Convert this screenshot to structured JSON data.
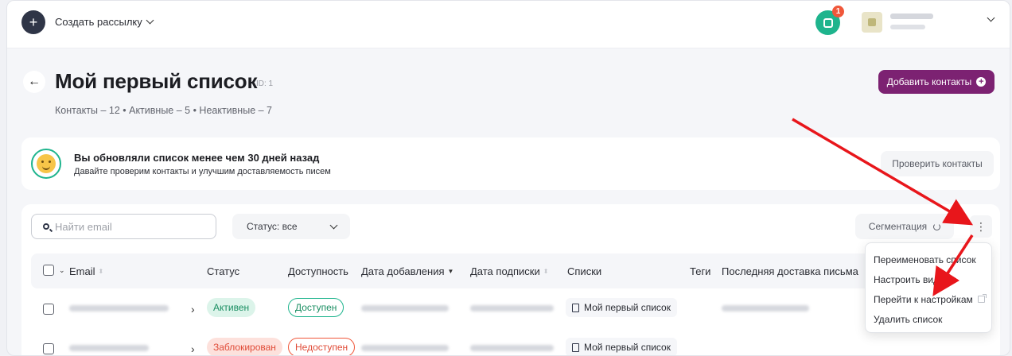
{
  "topbar": {
    "create_icon": "+",
    "create_label": "Создать рассылку",
    "notification_count": "1"
  },
  "header": {
    "title": "Мой первый список",
    "id_label": "ID: 1",
    "stats": "Контакты – 12 • Активные – 5 • Неактивные – 7",
    "back_icon": "←",
    "add_contacts_label": "Добавить контакты"
  },
  "banner": {
    "title": "Вы обновляли список менее чем 30 дней назад",
    "subtitle": "Давайте проверим контакты и улучшим доставляемость писем",
    "check_button": "Проверить контакты"
  },
  "toolbar": {
    "search_placeholder": "Найти email",
    "status_filter": "Статус: все",
    "segmentation": "Сегментация",
    "kebab": "⋮"
  },
  "table": {
    "columns": [
      "Email",
      "Статус",
      "Доступность",
      "Дата добавления",
      "Дата подписки",
      "Списки",
      "Теги",
      "Последняя доставка письма"
    ],
    "rows": [
      {
        "status": "Активен",
        "availability": "Доступен",
        "list": "Мой первый список"
      },
      {
        "status": "Заблокирован",
        "availability": "Недоступен",
        "list": "Мой первый список"
      }
    ]
  },
  "menu": {
    "items": [
      "Переименовать список",
      "Настроить вид",
      "Перейти к настройкам",
      "Удалить список"
    ]
  },
  "colors": {
    "brand": "#7c2272",
    "accent_green": "#1eb48d",
    "danger": "#f0573a",
    "annotation_arrow": "#e8161b"
  },
  "icons": [
    "plus-icon",
    "chevron-down-icon",
    "chat-icon",
    "back-arrow-icon",
    "smiley-icon",
    "search-icon",
    "refresh-icon",
    "kebab-icon",
    "sort-icon",
    "document-icon",
    "external-link-icon"
  ]
}
